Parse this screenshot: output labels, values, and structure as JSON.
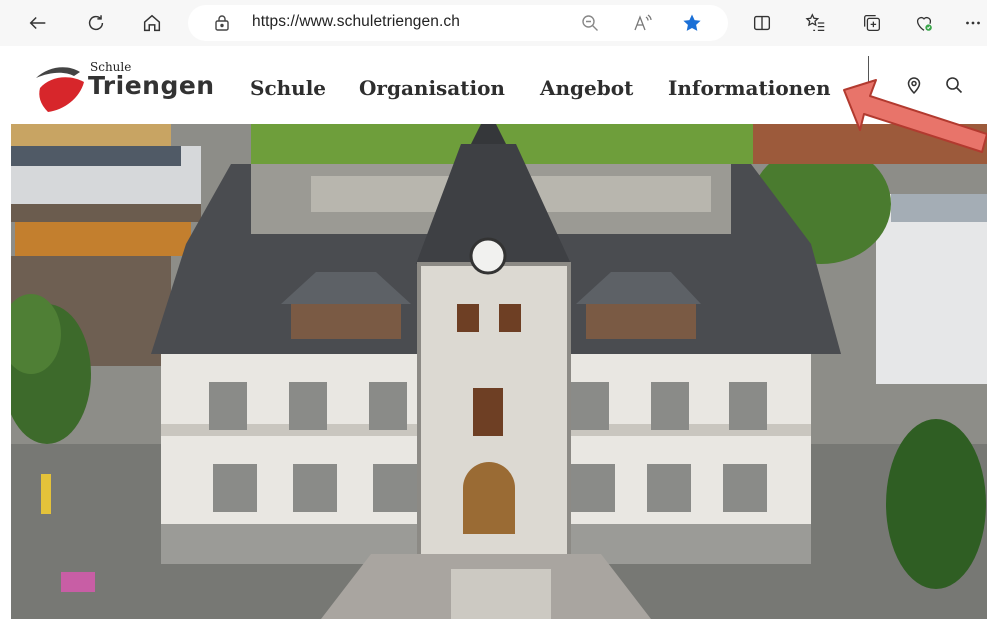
{
  "browser": {
    "url": "https://www.schuletriengen.ch",
    "icons": [
      "back-icon",
      "reload-icon",
      "home-icon",
      "lock-icon",
      "zoom-out-icon",
      "read-aloud-icon",
      "favorite-star-icon",
      "split-screen-icon",
      "favorites-list-icon",
      "collections-icon",
      "browser-essentials-icon",
      "more-icon"
    ],
    "accent_star": "#1a6fd6"
  },
  "site": {
    "logo_small": "Schule",
    "logo_big": "Triengen",
    "brand_red": "#d7262b",
    "nav": [
      "Schule",
      "Organisation",
      "Angebot",
      "Informationen"
    ],
    "icons": [
      "location-pin-icon",
      "search-icon"
    ]
  },
  "annotation": {
    "arrow_color": "#e8746a",
    "arrow_outline": "#b23a2f"
  }
}
